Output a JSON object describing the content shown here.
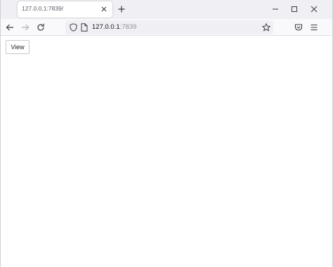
{
  "browser": {
    "tab": {
      "title": "127.0.0.1:7839/"
    },
    "urlbar": {
      "host": "127.0.0.1",
      "port": ":7839"
    },
    "icons": {
      "tab_close": "close-icon",
      "new_tab": "plus-icon",
      "minimize": "minimize-icon",
      "maximize": "maximize-icon",
      "close_window": "close-icon",
      "back": "arrow-left-icon",
      "forward": "arrow-right-icon",
      "reload": "reload-icon",
      "tracking_protection": "shield-icon",
      "page_info": "page-icon",
      "bookmark": "star-icon",
      "pocket": "pocket-icon",
      "menu": "hamburger-menu-icon"
    }
  },
  "page": {
    "view_button_label": "View"
  }
}
